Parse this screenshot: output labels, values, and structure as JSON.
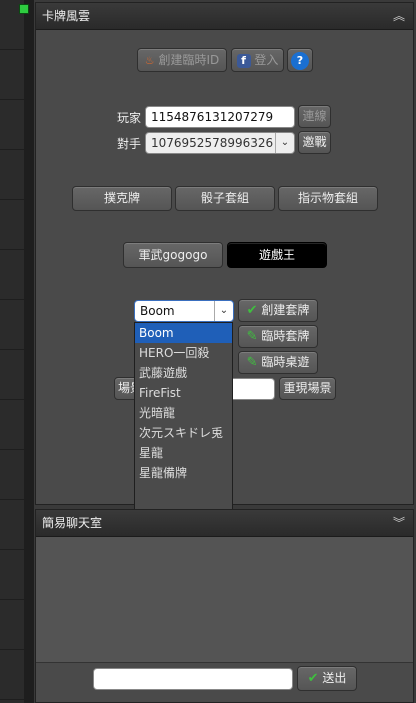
{
  "card_panel": {
    "title": "卡牌風雲",
    "collapse_icon": "chevrons-up-icon",
    "create_temp_id_label": "創建臨時ID",
    "login_label": "登入",
    "help_label": "?",
    "player_label": "玩家",
    "player_value": "1154876131207279",
    "connect_label": "連線",
    "opponent_label": "對手",
    "opponent_value": "1076952578996326",
    "challenge_label": "邀戰",
    "game_tabs": [
      "撲克牌",
      "骰子套組",
      "指示物套組"
    ],
    "deck_tabs": [
      "軍武gogogo",
      "遊戲王"
    ],
    "deck_select_value": "Boom",
    "deck_options": [
      "Boom",
      "HERO一回殺",
      "武藤遊戲",
      "FireFist",
      "光暗龍",
      "次元スキドレ兎",
      "星龍",
      "星龍備牌"
    ],
    "create_deck_label": "創建套牌",
    "temp_deck_label": "臨時套牌",
    "temp_table_label": "臨時桌遊",
    "scene_label": "場景",
    "scene_value": "",
    "replay_scene_label": "重現場景"
  },
  "chat_panel": {
    "title": "簡易聊天室",
    "collapse_icon": "chevrons-down-icon",
    "message_value": "",
    "send_label": "送出"
  },
  "colors": {
    "accent_selected": "#1f5fb8",
    "marker_green": "#2ecc40",
    "check_green": "#3fbf3f"
  }
}
